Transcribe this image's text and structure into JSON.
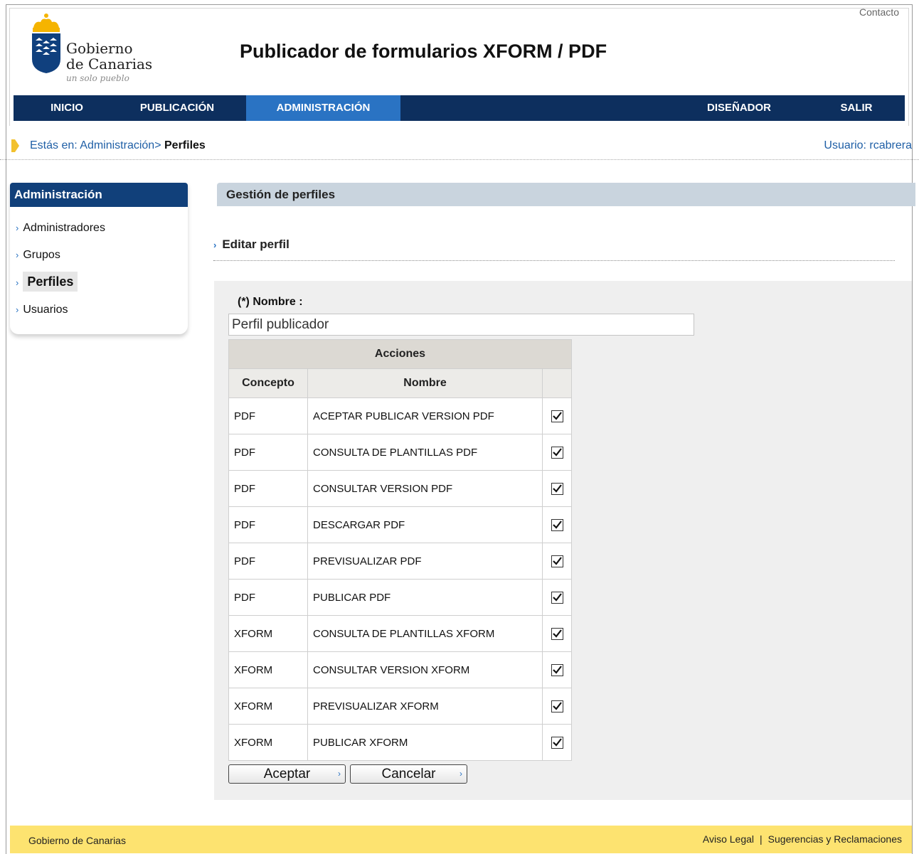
{
  "header": {
    "logo_name_line1": "Gobierno",
    "logo_name_line2": "de Canarias",
    "logo_tagline": "un solo pueblo",
    "site_title": "Publicador de formularios XFORM / PDF",
    "contact_link": "Contacto"
  },
  "nav": {
    "items": [
      {
        "label": "INICIO",
        "active": false
      },
      {
        "label": "PUBLICACIÓN",
        "active": false
      },
      {
        "label": "ADMINISTRACIÓN",
        "active": true
      },
      {
        "label": "DISEÑADOR",
        "active": false
      },
      {
        "label": "SALIR",
        "active": false
      }
    ]
  },
  "breadcrumb": {
    "prefix": "Estás en:",
    "link": "Administración>",
    "current": "Perfiles",
    "user": "Usuario: rcabrera"
  },
  "sidebar": {
    "title": "Administración",
    "items": [
      {
        "label": "Administradores",
        "active": false
      },
      {
        "label": "Grupos",
        "active": false
      },
      {
        "label": "Perfiles",
        "active": true
      },
      {
        "label": "Usuarios",
        "active": false
      }
    ]
  },
  "content": {
    "header": "Gestión de perfiles",
    "subtitle": "Editar perfil",
    "name_label": "(*) Nombre :",
    "name_value": "Perfil publicador"
  },
  "table": {
    "caption": "Acciones",
    "columns": [
      "Concepto",
      "Nombre",
      ""
    ],
    "rows": [
      {
        "concepto": "PDF",
        "nombre": "ACEPTAR PUBLICAR VERSION PDF",
        "checked": true
      },
      {
        "concepto": "PDF",
        "nombre": "CONSULTA DE PLANTILLAS PDF",
        "checked": true
      },
      {
        "concepto": "PDF",
        "nombre": "CONSULTAR VERSION PDF",
        "checked": true
      },
      {
        "concepto": "PDF",
        "nombre": "DESCARGAR PDF",
        "checked": true
      },
      {
        "concepto": "PDF",
        "nombre": "PREVISUALIZAR PDF",
        "checked": true
      },
      {
        "concepto": "PDF",
        "nombre": "PUBLICAR PDF",
        "checked": true
      },
      {
        "concepto": "XFORM",
        "nombre": "CONSULTA DE PLANTILLAS XFORM",
        "checked": true
      },
      {
        "concepto": "XFORM",
        "nombre": "CONSULTAR VERSION XFORM",
        "checked": true
      },
      {
        "concepto": "XFORM",
        "nombre": "PREVISUALIZAR XFORM",
        "checked": true
      },
      {
        "concepto": "XFORM",
        "nombre": "PUBLICAR XFORM",
        "checked": true
      }
    ]
  },
  "buttons": {
    "accept": "Aceptar",
    "cancel": "Cancelar"
  },
  "footer": {
    "left": "Gobierno de Canarias",
    "links": [
      "Aviso Legal",
      "Sugerencias y Reclamaciones"
    ]
  },
  "colors": {
    "nav_bg": "#0d2f5e",
    "nav_active": "#2a73c3",
    "sidebar_header": "#11407a",
    "content_header": "#c9d4de",
    "footer_bg": "#fde370",
    "link": "#1f5fa6"
  }
}
